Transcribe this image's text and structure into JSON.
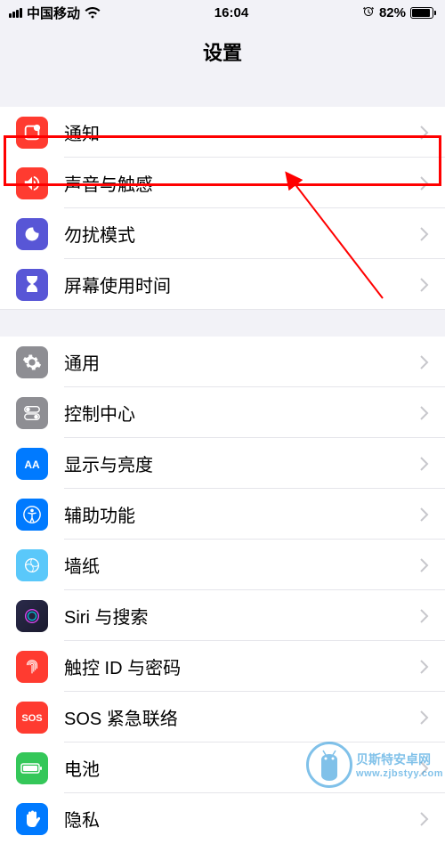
{
  "status": {
    "carrier": "中国移动",
    "time": "16:04",
    "battery": "82%"
  },
  "header": {
    "title": "设置"
  },
  "group1": [
    {
      "icon": "notifications",
      "color": "#ff3b30",
      "label": "通知"
    },
    {
      "icon": "sound",
      "color": "#ff3b30",
      "label": "声音与触感"
    },
    {
      "icon": "dnd",
      "color": "#5856d6",
      "label": "勿扰模式"
    },
    {
      "icon": "screentime",
      "color": "#5856d6",
      "label": "屏幕使用时间"
    }
  ],
  "group2": [
    {
      "icon": "general",
      "color": "#8e8e93",
      "label": "通用"
    },
    {
      "icon": "control",
      "color": "#8e8e93",
      "label": "控制中心"
    },
    {
      "icon": "display",
      "color": "#007aff",
      "label": "显示与亮度"
    },
    {
      "icon": "accessibility",
      "color": "#007aff",
      "label": "辅助功能"
    },
    {
      "icon": "wallpaper",
      "color": "#5ac8fa",
      "label": "墙纸"
    },
    {
      "icon": "siri",
      "color": "#1a1a2e",
      "label": "Siri 与搜索"
    },
    {
      "icon": "touchid",
      "color": "#ff3b30",
      "label": "触控 ID 与密码"
    },
    {
      "icon": "sos",
      "color": "#ff3b30",
      "label": "SOS 紧急联络"
    },
    {
      "icon": "battery",
      "color": "#34c759",
      "label": "电池"
    },
    {
      "icon": "privacy",
      "color": "#007aff",
      "label": "隐私"
    }
  ],
  "watermark": {
    "name": "贝斯特安卓网",
    "url": "www.zjbstyy.com"
  }
}
